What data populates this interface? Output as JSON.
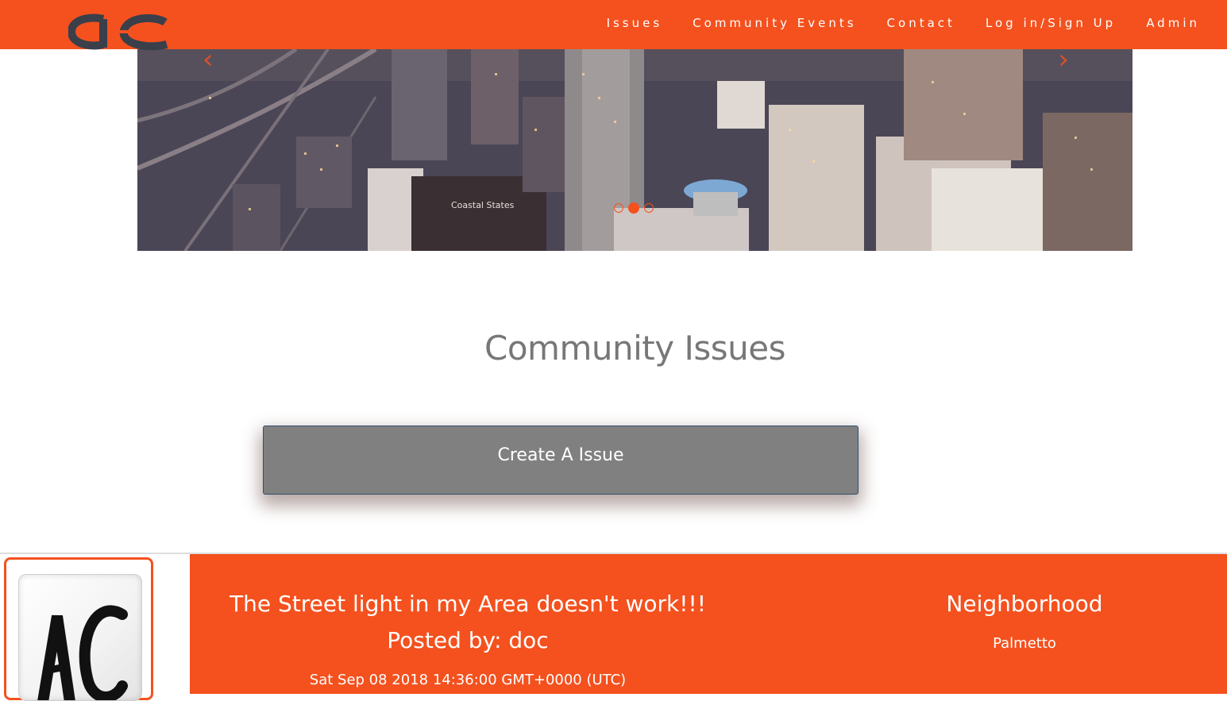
{
  "nav": {
    "logo_text": "ac",
    "links": [
      "Issues",
      "Community Events",
      "Contact",
      "Log in/Sign Up",
      "Admin"
    ]
  },
  "carousel": {
    "prev_icon": "chevron-left-icon",
    "next_icon": "chevron-right-icon",
    "slide_count": 3,
    "active_slide": 2,
    "sign_text": "Coastal States"
  },
  "main": {
    "title": "Community Issues",
    "create_button": "Create A Issue"
  },
  "issue": {
    "title": "The Street light in my Area doesn't work!!!",
    "posted_by": "Posted by: doc",
    "date": "Sat Sep 08 2018 14:36:00 GMT+0000 (UTC)",
    "neighborhood_label": "Neighborhood",
    "neighborhood": "Palmetto",
    "thumb_text": "AC"
  },
  "colors": {
    "accent": "#f4511e",
    "button_bg": "#808080",
    "title_gray": "#777777"
  }
}
